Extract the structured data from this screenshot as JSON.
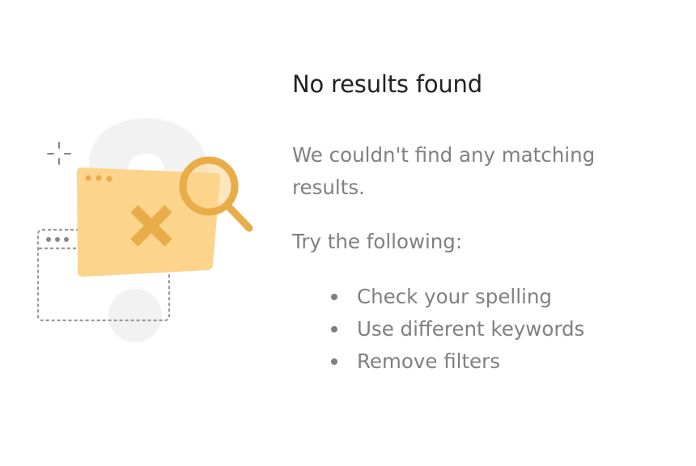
{
  "empty_state": {
    "title": "No results found",
    "message": "We couldn't find any matching results.",
    "try_label": "Try the following:",
    "tips": [
      {
        "label": "Check your spelling"
      },
      {
        "label": "Use different keywords"
      },
      {
        "label": "Remove filters"
      }
    ]
  },
  "illustration": {
    "icons": [
      "question-mark-icon",
      "sparkle-icon",
      "window-outline-icon",
      "folder-icon",
      "x-mark-icon",
      "magnifier-icon"
    ],
    "colors": {
      "question_mark": "#F2F2F2",
      "folder": "#FDD48C",
      "accent": "#E8AD48",
      "outline": "#888888"
    }
  },
  "colors": {
    "title": "#222222",
    "text": "#808080",
    "background": "#FFFFFF"
  }
}
